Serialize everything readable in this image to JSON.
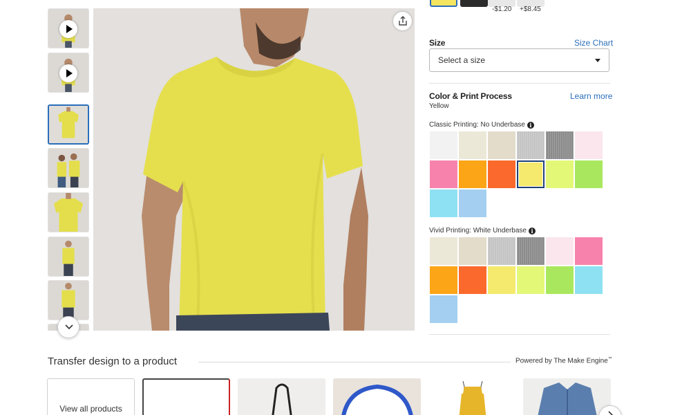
{
  "style_options": [
    {
      "label": "",
      "color": "#f3e560",
      "selected": true
    },
    {
      "label": "",
      "color": "#2b2b2b",
      "selected": false
    },
    {
      "label": "-$1.20",
      "color": "#e6e6e6",
      "selected": false
    },
    {
      "label": "+$8.45",
      "color": "#e6e6e6",
      "selected": false
    }
  ],
  "size": {
    "label": "Size",
    "chart_link": "Size Chart",
    "placeholder": "Select a size"
  },
  "color": {
    "label": "Color & Print Process",
    "learn_more": "Learn more",
    "selected_name": "Yellow",
    "classic_label": "Classic Printing: No Underbase",
    "vivid_label": "Vivid Printing: White Underbase",
    "info_glyph": "i",
    "classic_swatches": [
      "#f2f2f2",
      "#ece8d8",
      "#e3dccb",
      "#c4c4c4",
      "#8b8b8b",
      "#fbe6ee",
      "#f783ad",
      "#fba517",
      "#fb6a2c",
      "#f5ea6e",
      "#e4f878",
      "#a9e85e",
      "#8ee1f3",
      "#a4cff0"
    ],
    "classic_selected_index": 9,
    "vivid_swatches": [
      "#ece8d8",
      "#e3dccb",
      "#c4c4c4",
      "#8b8b8b",
      "#fbe6ee",
      "#f783ad",
      "#fba517",
      "#fb6a2c",
      "#f5ea6e",
      "#e4f878",
      "#a9e85e",
      "#8ee1f3",
      "#a4cff0"
    ]
  },
  "transfer": {
    "title": "Transfer design to a product",
    "powered_by": "Powered by The Make Engine",
    "trademark": "™",
    "view_all": "View all products"
  },
  "icons": {
    "share": "share-icon",
    "play": "play-icon",
    "chevron_down": "chevron-down-icon",
    "chevron_right": "chevron-right-icon"
  },
  "accent_color": "#2a6ebb",
  "shirt_color": "#e5df4e"
}
